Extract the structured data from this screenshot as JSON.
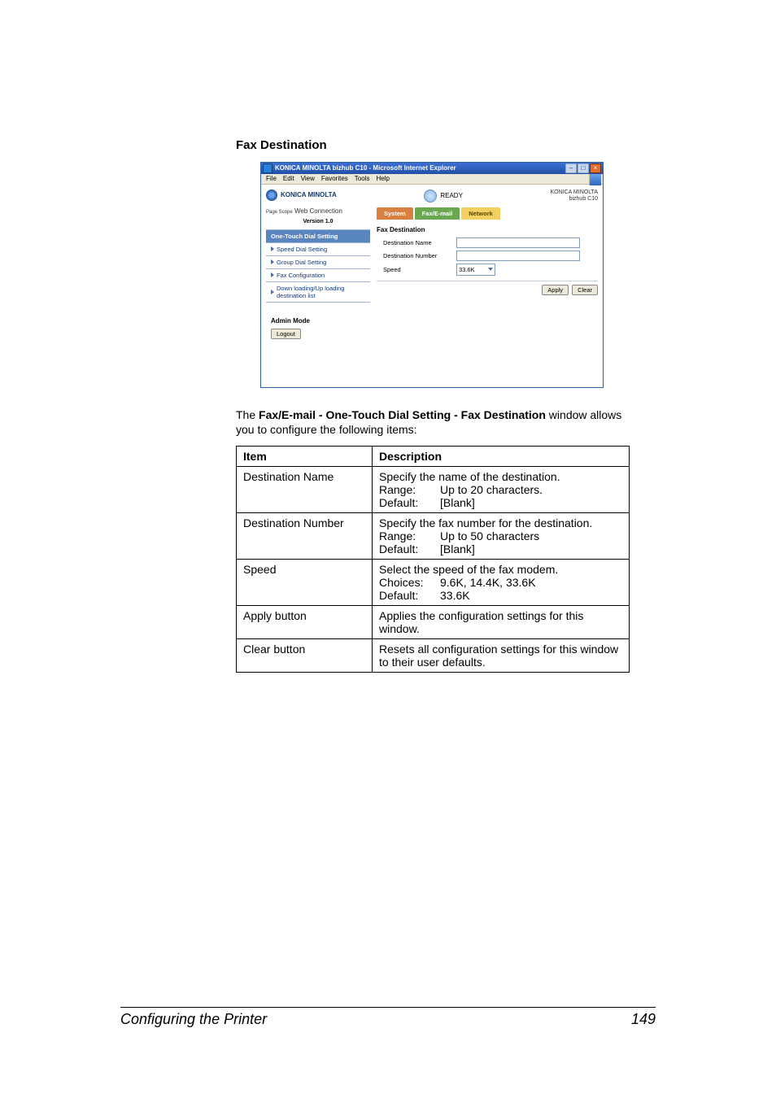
{
  "heading": "Fax Destination",
  "screenshot": {
    "ie_title": "KONICA MINOLTA bizhub C10 - Microsoft Internet Explorer",
    "menubar": [
      "File",
      "Edit",
      "View",
      "Favorites",
      "Tools",
      "Help"
    ],
    "brand": "KONICA MINOLTA",
    "status_text": "READY",
    "brand_right_line1": "KONICA MINOLTA",
    "brand_right_line2": "bizhub C10",
    "pst_web": "Web Connection",
    "pst_prefix": "Page Scope",
    "version": "Version 1.0",
    "nav": [
      "One-Touch Dial Setting",
      "Speed Dial Setting",
      "Group Dial Setting",
      "Fax Configuration",
      "Down loading/Up loading destination list"
    ],
    "admin_mode_label": "Admin Mode",
    "logout": "Logout",
    "tabs": {
      "system": "System",
      "fax": "Fax/E-mail",
      "network": "Network"
    },
    "panel_title": "Fax Destination",
    "labels": {
      "dest_name": "Destination Name",
      "dest_number": "Destination Number",
      "speed": "Speed"
    },
    "speed_value": "33.6K",
    "buttons": {
      "apply": "Apply",
      "clear": "Clear"
    }
  },
  "intro_pre": "The ",
  "intro_bold": "Fax/E-mail - One-Touch Dial Setting - Fax Destination",
  "intro_post": " window allows you to configure the following items:",
  "table": {
    "headers": {
      "item": "Item",
      "desc": "Description"
    },
    "rows": [
      {
        "item": "Destination Name",
        "line1": "Specify the name of the destination.",
        "range_label": "Range:",
        "range_value": "Up to 20 characters.",
        "default_label": "Default:",
        "default_value": "[Blank]"
      },
      {
        "item": "Destination Number",
        "line1": "Specify the fax number for the destination.",
        "range_label": "Range:",
        "range_value": "Up to 50 characters",
        "default_label": "Default:",
        "default_value": "[Blank]"
      },
      {
        "item": "Speed",
        "line1": "Select the speed of the fax modem.",
        "range_label": "Choices:",
        "range_value": "9.6K, 14.4K, 33.6K",
        "default_label": "Default:",
        "default_value": "33.6K"
      },
      {
        "item": "Apply button",
        "line1": "Applies the configuration settings for this window."
      },
      {
        "item": "Clear button",
        "line1": "Resets all configuration settings for this window to their user defaults."
      }
    ]
  },
  "footer": {
    "left": "Configuring the Printer",
    "right": "149"
  }
}
